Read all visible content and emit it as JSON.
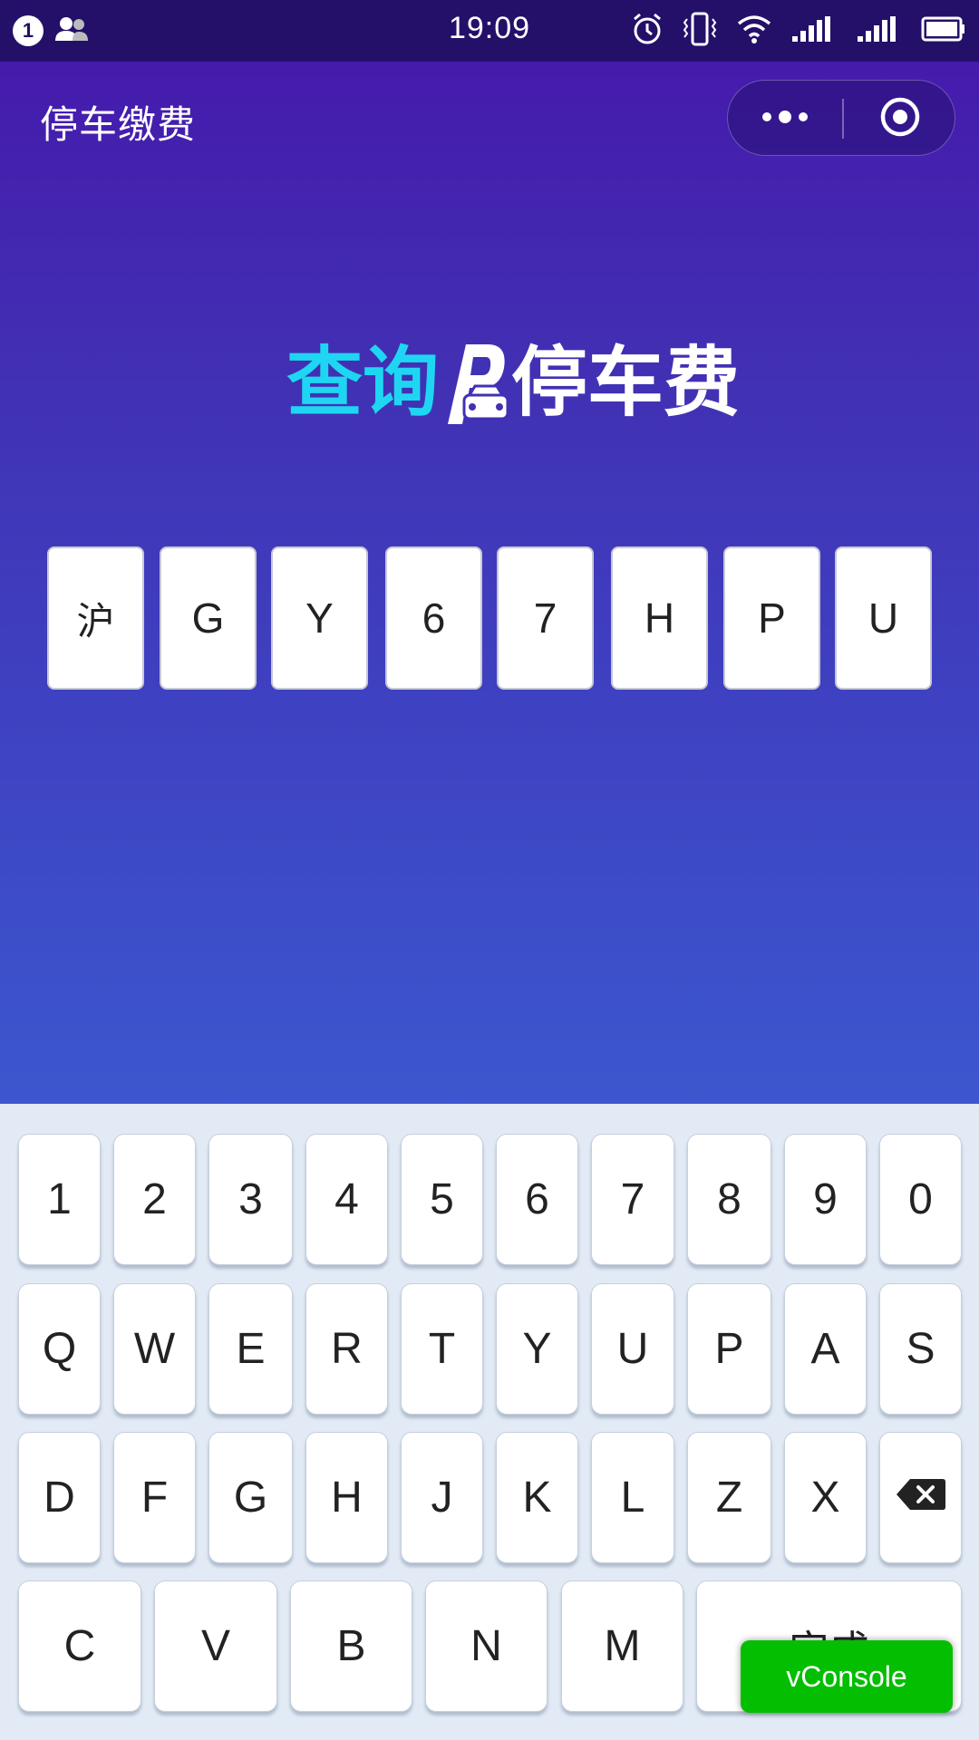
{
  "status_bar": {
    "notification_count": "1",
    "time": "19:09"
  },
  "nav": {
    "title": "停车缴费",
    "more_icon": "more-dots-icon",
    "close_icon": "target-circle-icon"
  },
  "logo": {
    "part1": "查询",
    "part2": "停车费"
  },
  "plate": [
    "沪",
    "G",
    "Y",
    "6",
    "7",
    "H",
    "P",
    "U"
  ],
  "keyboard": {
    "row1": [
      "1",
      "2",
      "3",
      "4",
      "5",
      "6",
      "7",
      "8",
      "9",
      "0"
    ],
    "row2": [
      "Q",
      "W",
      "E",
      "R",
      "T",
      "Y",
      "U",
      "P",
      "A",
      "S"
    ],
    "row3": [
      "D",
      "F",
      "G",
      "H",
      "J",
      "K",
      "L",
      "Z",
      "X"
    ],
    "row4": [
      "C",
      "V",
      "B",
      "N",
      "M"
    ],
    "done_label": "完成",
    "backspace_icon": "backspace-icon"
  },
  "vconsole_label": "vConsole",
  "colors": {
    "status_bar": "#241069",
    "gradient_top": "#4616ab",
    "gradient_bottom": "#3c57cf",
    "logo_accent": "#1fd6f2",
    "keyboard_bg": "#e1eaf5",
    "vconsole": "#04be02"
  }
}
